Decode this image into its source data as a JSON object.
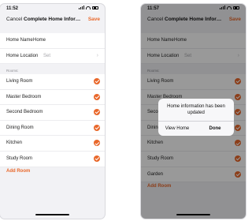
{
  "left_screen": {
    "status": {
      "time": "11:52"
    },
    "nav": {
      "cancel": "Cancel",
      "title": "Complete Home Informa...",
      "save": "Save"
    },
    "home_name": {
      "label": "Home Name",
      "value": "Home"
    },
    "home_location": {
      "label": "Home Location",
      "value": "Set"
    },
    "rooms_label": "Rooms:",
    "rooms": [
      "Living Room",
      "Master Bedroom",
      "Second Bedroom",
      "Dining Room",
      "Kitchen",
      "Study Room"
    ],
    "add_room": "Add Room"
  },
  "right_screen": {
    "status": {
      "time": "11:57"
    },
    "nav": {
      "cancel": "Cancel",
      "title": "Complete Home Informa...",
      "save": "Save"
    },
    "home_name": {
      "label": "Home Name",
      "value": "Home"
    },
    "home_location": {
      "label": "Home Location",
      "value": "Set"
    },
    "rooms_label": "Rooms:",
    "rooms": [
      "Living Room",
      "Master Bedroom",
      "Second Bedroom",
      "Dining Room",
      "Kitchen",
      "Study Room",
      "Garden"
    ],
    "add_room": "Add Room",
    "alert": {
      "message": "Home information has been updated",
      "left_button": "View Home",
      "right_button": "Done"
    }
  },
  "colors": {
    "accent": "#e9682b",
    "background": "#f2f2f5",
    "overlay": "rgba(0,0,0,0.40)"
  },
  "icons": {
    "check": "check-circle-icon",
    "chevron": "chevron-right-icon"
  }
}
